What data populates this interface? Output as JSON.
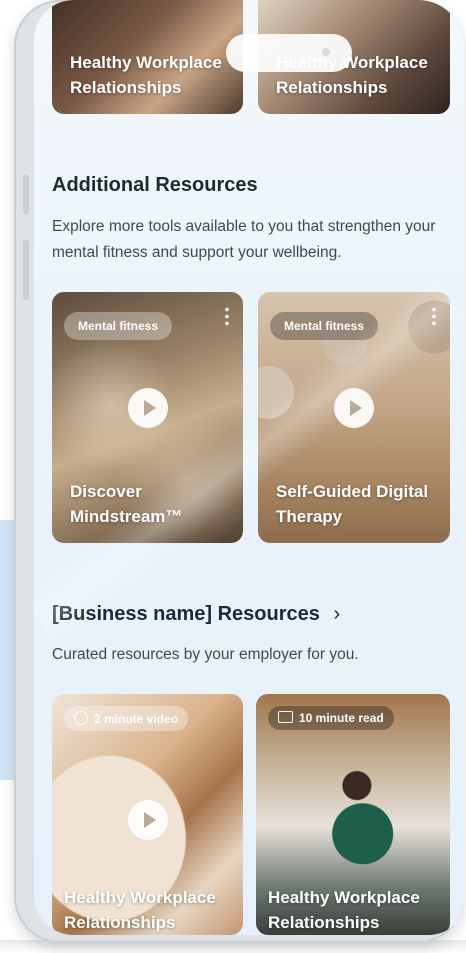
{
  "top_cards": [
    {
      "title": "Healthy Workplace Relationships"
    },
    {
      "title": "Healthy Workplace Relationships"
    }
  ],
  "additional": {
    "heading": "Additional Resources",
    "description": "Explore more tools available to you that strengthen your mental fitness and support your wellbeing.",
    "cards": [
      {
        "tag": "Mental fitness",
        "title": "Discover Mindstream™"
      },
      {
        "tag": "Mental fitness",
        "title": "Self-Guided Digital Therapy"
      }
    ]
  },
  "business": {
    "heading": "[Business name] Resources",
    "chevron": "›",
    "description": "Curated resources by your employer for you.",
    "cards": [
      {
        "badge": "2 minute video",
        "badge_icon": "play-circle-icon",
        "title": "Healthy Workplace Relationships"
      },
      {
        "badge": "10 minute read",
        "badge_icon": "book-icon",
        "title": "Healthy Workplace Relationships"
      }
    ]
  },
  "colors": {
    "heading": "#1c2a35",
    "body": "#3e4a54",
    "screen_bg": "#eaf3fb"
  }
}
